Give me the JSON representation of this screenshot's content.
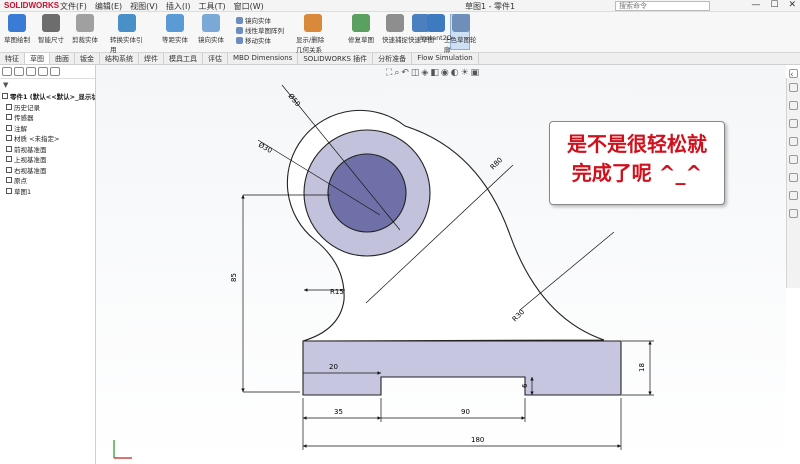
{
  "titlebar": {
    "logo": "SOLIDWORKS",
    "menus": [
      "文件(F)",
      "编辑(E)",
      "视图(V)",
      "插入(I)",
      "工具(T)",
      "窗口(W)"
    ],
    "document": "草图1 - 零件1",
    "search_placeholder": "搜索命令",
    "win_minimize": "—",
    "win_maximize": "☐",
    "win_close": "✕"
  },
  "ribbon": {
    "large_buttons": [
      {
        "label": "草图绘制"
      },
      {
        "label": "智能尺寸"
      },
      {
        "label": "剪裁实体"
      },
      {
        "label": "转换实体引用"
      },
      {
        "label": "等距实体"
      },
      {
        "label": "镜向实体"
      },
      {
        "label": "线性草图阵列"
      },
      {
        "label": "移动实体"
      },
      {
        "label": "显示/删除几何关系"
      },
      {
        "label": "修复草图"
      },
      {
        "label": "快速捕捉"
      },
      {
        "label": "快速草图"
      },
      {
        "label": "Instant2D"
      },
      {
        "label": "上色草图轮廓"
      }
    ],
    "small_items": [
      "镜向实体",
      "线性草图阵列",
      "移动实体",
      "显示/删除几何关系"
    ]
  },
  "tabs": [
    "特征",
    "草图",
    "曲面",
    "钣金",
    "结构系统",
    "焊件",
    "模具工具",
    "评估",
    "MBD Dimensions",
    "SOLIDWORKS 插件",
    "分析准备",
    "Flow Simulation"
  ],
  "active_tab": "草图",
  "feature_tree": {
    "filter_label": "▼",
    "root": "零件1 (默认<<默认>_显示状态 1>)",
    "items": [
      "历史记录",
      "传感器",
      "注解",
      "材质 <未指定>",
      "前视基准面",
      "上视基准面",
      "右视基准面",
      "原点",
      "草图1"
    ]
  },
  "view_toolbar_icon_names": [
    "zoom-to-fit-icon",
    "zoom-area-icon",
    "previous-view-icon",
    "section-view-icon",
    "view-orientation-icon",
    "display-style-icon",
    "hide-show-icon",
    "edit-appearance-icon",
    "apply-scene-icon",
    "view-settings-icon"
  ],
  "callout": {
    "line1": "是不是很轻松就",
    "line2": "完成了呢 ^_^"
  },
  "dimensions": {
    "outer_diameter": "Ø50",
    "inner_diameter": "Ø30",
    "big_fillet": "R80",
    "small_fillet": "R15",
    "tangent_fillet": "R30",
    "height": "85",
    "base_thickness": "20",
    "right_height": "18",
    "slot_depth": "6",
    "left_offset": "35",
    "slot_width": "90",
    "total_width": "180"
  },
  "colors": {
    "part_fill": "#c6c6e0",
    "bore_fill": "#7070a8",
    "callout_text": "#d1101c",
    "ribbon_bg": "#f7f7f7",
    "selected_tool": "#cfe0f4"
  }
}
